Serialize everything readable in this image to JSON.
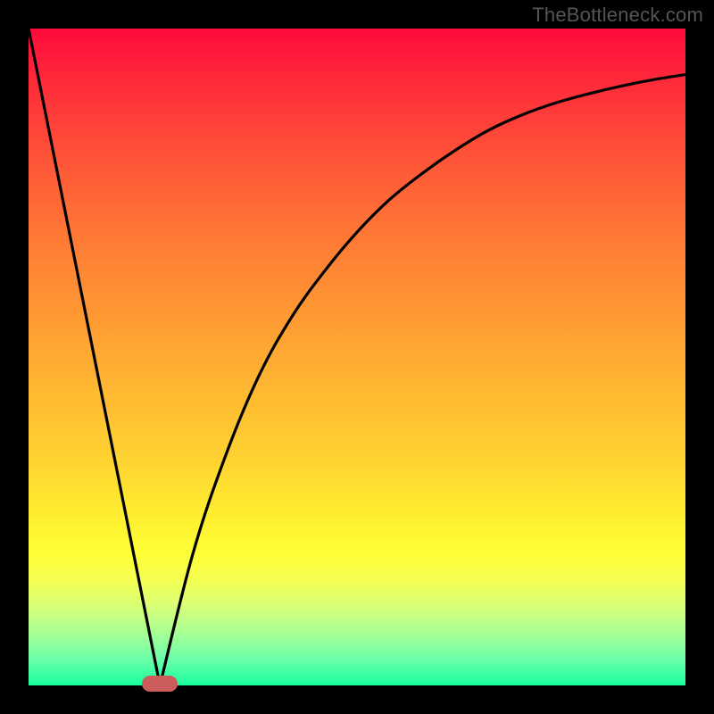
{
  "watermark": "TheBottleneck.com",
  "chart_data": {
    "type": "line",
    "title": "",
    "xlabel": "",
    "ylabel": "",
    "xlim": [
      0,
      100
    ],
    "ylim": [
      0,
      100
    ],
    "grid": false,
    "legend": false,
    "series": [
      {
        "name": "left-branch",
        "x": [
          0,
          20
        ],
        "values": [
          100,
          0
        ]
      },
      {
        "name": "right-branch",
        "x": [
          20,
          25,
          30,
          35,
          40,
          45,
          50,
          55,
          60,
          65,
          70,
          75,
          80,
          85,
          90,
          95,
          100
        ],
        "values": [
          0,
          20,
          35,
          47,
          56,
          63,
          69,
          74,
          78,
          81.5,
          84.5,
          86.8,
          88.6,
          90,
          91.2,
          92.2,
          93
        ]
      }
    ],
    "vertex": {
      "x": 20,
      "y": 0
    },
    "marker": {
      "x": 20,
      "y": 0,
      "color": "#cd5c5c"
    },
    "gradient_stops": [
      {
        "pos": 0,
        "color": "#ff0a3c"
      },
      {
        "pos": 50,
        "color": "#ffb832"
      },
      {
        "pos": 80,
        "color": "#feff36"
      },
      {
        "pos": 100,
        "color": "#18ff9e"
      }
    ]
  }
}
